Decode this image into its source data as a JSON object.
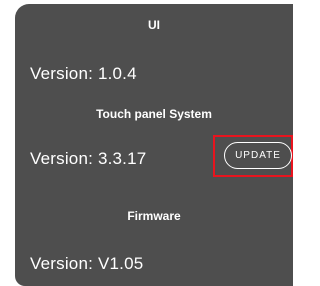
{
  "sections": [
    {
      "title": "UI",
      "version": "Version: 1.0.4"
    },
    {
      "title": "Touch panel System",
      "version": "Version: 3.3.17",
      "button_label": "UPDATE"
    },
    {
      "title": "Firmware",
      "version": "Version:  V1.05"
    }
  ],
  "colors": {
    "panel_background": "#4e4e4e",
    "text": "#ffffff",
    "highlight_outline": "#e8141e"
  }
}
